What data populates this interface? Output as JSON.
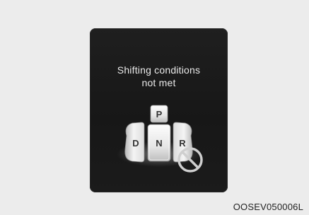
{
  "screen": {
    "message_line1": "Shifting conditions",
    "message_line2": "not met"
  },
  "shifter": {
    "park_label": "P",
    "drive_label": "D",
    "neutral_label": "N",
    "reverse_label": "R",
    "prohibited_icon": "no-entry-circle-slash",
    "active_gear": "N"
  },
  "caption": {
    "figure_code": "OOSEV050006L"
  },
  "colors": {
    "page_bg": "#ececec",
    "panel_bg": "#1b1b1b",
    "text": "#e9e9e9",
    "button_light": "#f2f2f2",
    "button_mid": "#cfcfcf"
  }
}
